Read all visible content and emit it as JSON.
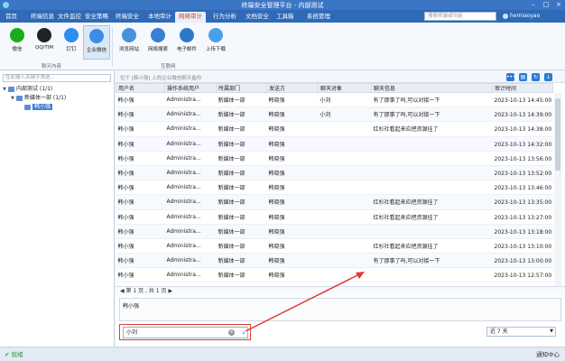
{
  "window": {
    "title": "终端安全管理平台 - 内部测试"
  },
  "menubar": {
    "items": [
      "首页",
      "终端信息",
      "文件监控",
      "安全策略",
      "终端安全",
      "本地审计",
      "网络审计",
      "行为分析",
      "文档安全",
      "工具箱",
      "系统管理"
    ],
    "active_index": 6,
    "search_placeholder": "搜索终端或功能",
    "user": "hemiaoyao"
  },
  "ribbon": {
    "buttons": [
      {
        "label": "微信",
        "icon": "wechat-icon",
        "color": "#1aad19"
      },
      {
        "label": "QQ/TIM",
        "icon": "qq-icon",
        "color": "#222222"
      },
      {
        "label": "钉钉",
        "icon": "dingtalk-icon",
        "color": "#2d8cf0"
      },
      {
        "label": "企业微信",
        "icon": "wecom-icon",
        "color": "#3b8ee8"
      },
      {
        "label": "浏览网站",
        "icon": "browse-icon",
        "color": "#4a8fdb"
      },
      {
        "label": "网络搜索",
        "icon": "web-search-icon",
        "color": "#3a7ed6"
      },
      {
        "label": "电子邮件",
        "icon": "email-icon",
        "color": "#2f78c8"
      },
      {
        "label": "上传下载",
        "icon": "cloud-upload-icon",
        "color": "#4aa1e6"
      }
    ],
    "groups": [
      "聊天內容",
      "互联网"
    ]
  },
  "tree": {
    "filter_placeholder": "在此输入关键字筛选...",
    "nodes": [
      {
        "label": "内部测试 (1/1)",
        "level": 0,
        "toggle": "▼"
      },
      {
        "label": "新媒体一部 (1/1)",
        "level": 1,
        "toggle": "▼"
      },
      {
        "label": "韩小强",
        "level": 2,
        "toggle": "",
        "selected": true
      }
    ]
  },
  "toolbar": {
    "hint": "位于 [韩小强] 上的企业微信聊天备份"
  },
  "table": {
    "columns": [
      "用户名",
      "操作系统用户",
      "所属部门",
      "发送方",
      "聊天对象",
      "聊天信息",
      "审计时间"
    ],
    "rows": [
      [
        "韩小强",
        "Administra...",
        "新媒体一部",
        "韩晓强",
        "小刘",
        "有了那事了吗,可以对接一下",
        "2023-10-13 14:45:00"
      ],
      [
        "韩小强",
        "Administra...",
        "新媒体一部",
        "韩晓强",
        "小刘",
        "有了那事了吗,可以对接一下",
        "2023-10-13 14:39:00"
      ],
      [
        "韩小强",
        "Administra...",
        "新媒体一部",
        "韩晓强",
        "",
        "红杉社看起来应把资源挂了",
        "2023-10-13 14:38:00"
      ],
      [
        "韩小强",
        "Administra...",
        "新媒体一部",
        "韩晓强",
        "",
        "",
        "2023-10-13 14:32:00"
      ],
      [
        "韩小强",
        "Administra...",
        "新媒体一部",
        "韩晓强",
        "",
        "",
        "2023-10-13 13:56:00"
      ],
      [
        "韩小强",
        "Administra...",
        "新媒体一部",
        "韩晓强",
        "",
        "",
        "2023-10-13 13:52:00"
      ],
      [
        "韩小强",
        "Administra...",
        "新媒体一部",
        "韩晓强",
        "",
        "",
        "2023-10-13 13:46:00"
      ],
      [
        "韩小强",
        "Administra...",
        "新媒体一部",
        "韩晓强",
        "",
        "红杉社看起来应把资源挂了",
        "2023-10-13 13:35:00"
      ],
      [
        "韩小强",
        "Administra...",
        "新媒体一部",
        "韩晓强",
        "",
        "红杉社看起来应把资源挂了",
        "2023-10-13 13:27:00"
      ],
      [
        "韩小强",
        "Administra...",
        "新媒体一部",
        "韩晓强",
        "",
        "",
        "2023-10-13 13:18:00"
      ],
      [
        "韩小强",
        "Administra...",
        "新媒体一部",
        "韩晓强",
        "",
        "红杉社看起来应把资源挂了",
        "2023-10-13 13:10:00"
      ],
      [
        "韩小强",
        "Administra...",
        "新媒体一部",
        "韩晓强",
        "",
        "有了那事了吗,可以对接一下",
        "2023-10-13 13:00:00"
      ],
      [
        "韩小强",
        "Administra...",
        "新媒体一部",
        "韩晓强",
        "",
        "",
        "2023-10-13 12:57:00"
      ]
    ]
  },
  "pager": {
    "text": "第 1 页 , 共 1 页"
  },
  "preview": {
    "text": "韩小强"
  },
  "search": {
    "value": "小刘"
  },
  "range": {
    "value": "近 7 天"
  },
  "statusbar": {
    "ok": "就绪",
    "notice": "通知中心"
  },
  "colors": {
    "accent": "#2f6ab8",
    "highlight": "#f2c744",
    "annotation": "#e23b2e"
  }
}
